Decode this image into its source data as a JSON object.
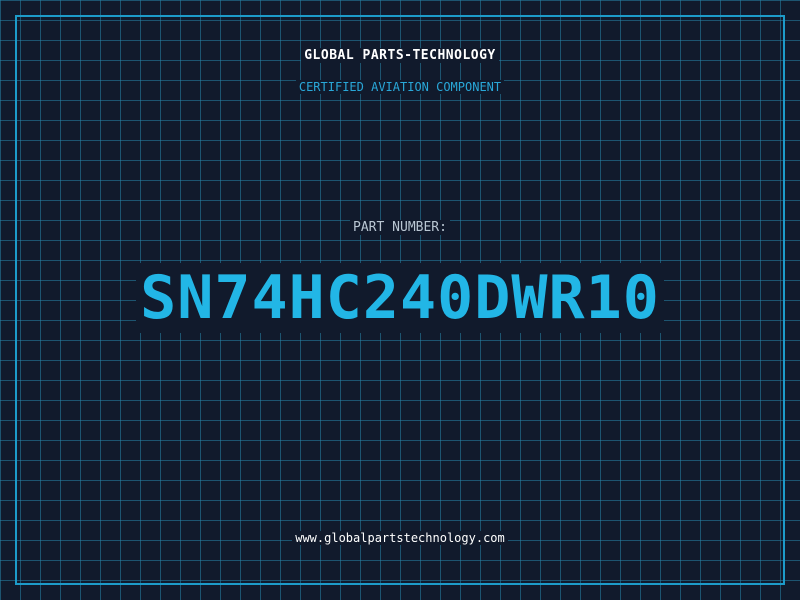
{
  "company": {
    "name": "GLOBAL PARTS-TECHNOLOGY",
    "tagline": "CERTIFIED AVIATION COMPONENT"
  },
  "part": {
    "label": "PART NUMBER:",
    "number": "SN74HC240DWR10"
  },
  "footer": {
    "website": "www.globalpartstechnology.com"
  },
  "colors": {
    "background": "#111a2c",
    "grid": "#2684a8",
    "accent": "#22b6e6",
    "frame": "#1d9bc9"
  }
}
